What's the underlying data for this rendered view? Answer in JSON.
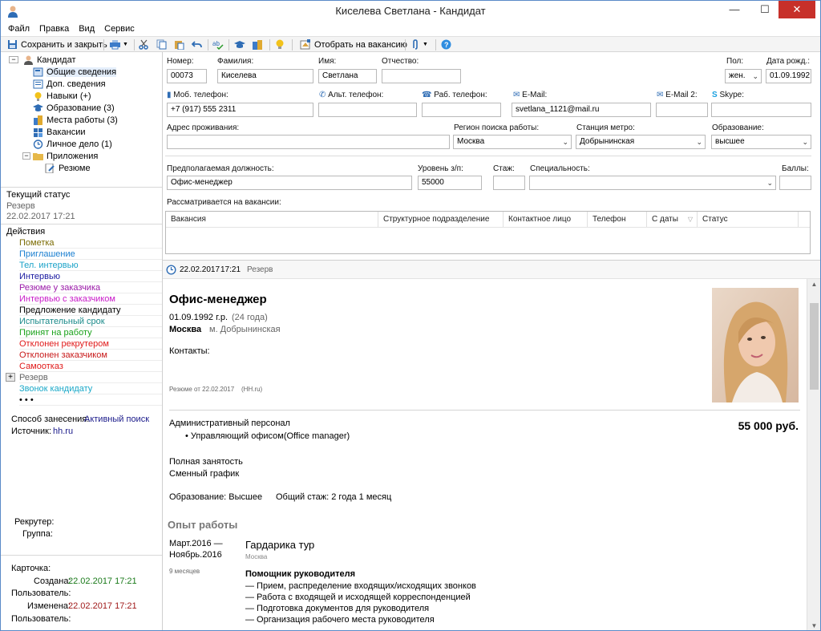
{
  "window": {
    "title": "Киселева Светлана - Кандидат",
    "minimize": "—",
    "maximize": "☐",
    "close": "✕"
  },
  "menu": [
    "Файл",
    "Правка",
    "Вид",
    "Сервис"
  ],
  "toolbar": {
    "save_close": "Сохранить и закрыть",
    "select_vacancy": "Отобрать на вакансию"
  },
  "tree": {
    "root": "Кандидат",
    "items": [
      "Общие сведения",
      "Доп. сведения",
      "Навыки (+)",
      "Образование (3)",
      "Места работы (3)",
      "Вакансии",
      "Личное дело  (1)",
      "Приложения"
    ],
    "sub": "Резюме"
  },
  "status": {
    "header": "Текущий статус",
    "value": "Резерв",
    "date": "22.02.2017 17:21"
  },
  "actions": {
    "header": "Действия",
    "items": [
      {
        "label": "Пометка",
        "color": "#7a6a00"
      },
      {
        "label": "Приглашение",
        "color": "#1a7fd0"
      },
      {
        "label": "Тел. интервью",
        "color": "#1aa2c8"
      },
      {
        "label": "Интервью",
        "color": "#1a1aa0"
      },
      {
        "label": "Резюме у заказчика",
        "color": "#9a1aa8"
      },
      {
        "label": "Интервью с заказчиком",
        "color": "#c81ac8"
      },
      {
        "label": "Предложение кандидату",
        "color": "#000000"
      },
      {
        "label": "Испытательный срок",
        "color": "#1a8a8a"
      },
      {
        "label": "Принят на работу",
        "color": "#1aa21a"
      },
      {
        "label": "Отклонен рекрутером",
        "color": "#e01a1a"
      },
      {
        "label": "Отклонен заказчиком",
        "color": "#c81a1a"
      },
      {
        "label": "Самоотказ",
        "color": "#e01a1a"
      },
      {
        "label": "Резерв",
        "color": "#666666"
      },
      {
        "label": "Звонок кандидату",
        "color": "#1aa8c8"
      },
      {
        "label": "• • •",
        "color": "#000000"
      }
    ],
    "plus": "+"
  },
  "source_info": {
    "method_label": "Способ занесения:",
    "method_value": "Активный поиск",
    "source_label": "Источник:",
    "source_value": "hh.ru"
  },
  "recruiter": {
    "recruiter_label": "Рекрутер:",
    "group_label": "Группа:"
  },
  "card": {
    "header": "Карточка:",
    "created_label": "Создана:",
    "created_value": "22.02.2017 17:21",
    "user_label": "Пользователь:",
    "changed_label": "Изменена:",
    "changed_value": "22.02.2017 17:21",
    "user_label2": "Пользователь:"
  },
  "form": {
    "number_label": "Номер:",
    "number": "00073",
    "surname_label": "Фамилия:",
    "surname": "Киселева",
    "name_label": "Имя:",
    "name": "Светлана",
    "patronymic_label": "Отчество:",
    "patronymic": "",
    "sex_label": "Пол:",
    "sex": "жен.",
    "birth_label": "Дата рожд.:",
    "birth": "01.09.1992",
    "mobile_label": "Моб. телефон:",
    "mobile": "+7 (917) 555 2311",
    "alt_phone_label": "Альт. телефон:",
    "alt_phone": "",
    "work_phone_label": "Раб. телефон:",
    "work_phone": "",
    "email_label": "E-Mail:",
    "email": "svetlana_1121@mail.ru",
    "email2_label": "E-Mail 2:",
    "email2": "",
    "skype_label": "Skype:",
    "skype": "",
    "address_label": "Адрес проживания:",
    "address": "",
    "region_label": "Регион поиска работы:",
    "region": "Москва",
    "metro_label": "Станция метро:",
    "metro": "Добрынинская",
    "education_label": "Образование:",
    "education": "высшее",
    "position_label": "Предполагаемая должность:",
    "position": "Офис-менеджер",
    "salary_label": "Уровень з/п:",
    "salary": "55000",
    "experience_label": "Стаж:",
    "experience": "",
    "specialty_label": "Специальность:",
    "specialty": "",
    "score_label": "Баллы:",
    "score": "",
    "vacancies_label": "Рассматривается на вакансии:",
    "columns": [
      "Вакансия",
      "Структурное подразделение",
      "Контактное лицо",
      "Телефон",
      "С даты",
      "Статус"
    ]
  },
  "status_bar": {
    "date": "22.02.2017",
    "time": "17:21",
    "status": "Резерв"
  },
  "resume": {
    "title": "Офис-менеджер",
    "birth": "01.09.1992 г.р.",
    "age": "(24 года)",
    "city": "Москва",
    "metro": "м. Добрынинская",
    "contacts": "Контакты:",
    "source_note": "Резюме от 22.02.2017",
    "source_site": "(HH.ru)",
    "area": "Административный персонал",
    "salary": "55 000 руб.",
    "role": "Управляющий офисом(Office manager)",
    "employment": "Полная занятость",
    "schedule": "Сменный график",
    "education": "Образование: Высшее",
    "total_exp": "Общий стаж: 2 года 1 месяц",
    "exp_header": "Опыт работы",
    "job": {
      "period1": "Март.2016 —",
      "period2": "Ноябрь.2016",
      "duration": "9 месяцев",
      "company": "Гардарика тур",
      "city": "Москва",
      "position": "Помощник руководителя",
      "duties": [
        "— Прием, распределение входящих/исходящих звонков",
        "— Работа с входящей и исходящей корреспонденцией",
        "— Подготовка документов для руководителя",
        "— Организация рабочего места руководителя"
      ]
    }
  }
}
